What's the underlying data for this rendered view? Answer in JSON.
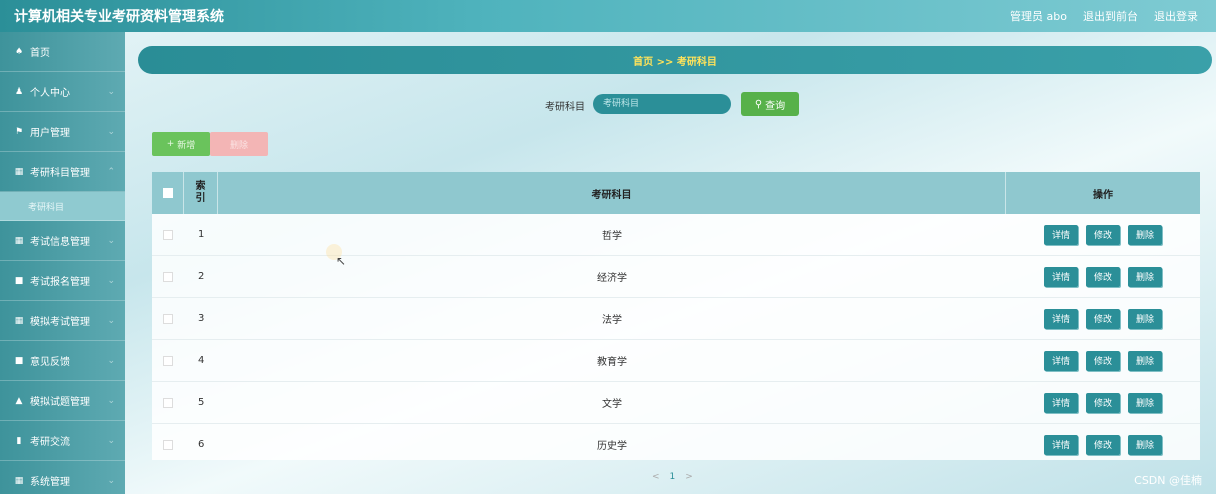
{
  "app": {
    "title": "计算机相关专业考研资料管理系统",
    "admin_label": "管理员 abo",
    "exit_front_label": "退出到前台",
    "logout_label": "退出登录"
  },
  "sidebar": {
    "items": [
      {
        "icon": "home-icon",
        "glyph": "♠",
        "label": "首页"
      },
      {
        "icon": "user-icon",
        "glyph": "♟",
        "label": "个人中心"
      },
      {
        "icon": "flag-icon",
        "glyph": "⚑",
        "label": "用户管理"
      },
      {
        "icon": "grid-icon",
        "glyph": "▦",
        "label": "考研科目管理"
      },
      {
        "icon": "grid-icon",
        "glyph": "▦",
        "label": "考试信息管理"
      },
      {
        "icon": "doc-icon",
        "glyph": "■",
        "label": "考试报名管理"
      },
      {
        "icon": "grid-icon",
        "glyph": "▦",
        "label": "模拟考试管理"
      },
      {
        "icon": "doc-icon",
        "glyph": "■",
        "label": "意见反馈"
      },
      {
        "icon": "bank-icon",
        "glyph": "▲",
        "label": "模拟试题管理"
      },
      {
        "icon": "chart-icon",
        "glyph": "▮",
        "label": "考研交流"
      },
      {
        "icon": "grid-icon",
        "glyph": "▦",
        "label": "系统管理"
      }
    ],
    "submenu_label": "考研科目"
  },
  "breadcrumb": {
    "text": "首页 >> 考研科目"
  },
  "search": {
    "label": "考研科目",
    "placeholder": "考研科目",
    "button_label": "查询"
  },
  "actions": {
    "add_label": "新增",
    "delete_label": "删除"
  },
  "table": {
    "headers": {
      "index": "索引",
      "subject": "考研科目",
      "ops": "操作"
    },
    "rows": [
      {
        "index": "1",
        "subject": "哲学"
      },
      {
        "index": "2",
        "subject": "经济学"
      },
      {
        "index": "3",
        "subject": "法学"
      },
      {
        "index": "4",
        "subject": "教育学"
      },
      {
        "index": "5",
        "subject": "文学"
      },
      {
        "index": "6",
        "subject": "历史学"
      }
    ],
    "row_ops": {
      "detail": "详情",
      "edit": "修改",
      "delete": "删除"
    }
  },
  "pager": {
    "prev": "<",
    "current": "1",
    "next": ">"
  },
  "watermark": "CSDN @佳楠"
}
